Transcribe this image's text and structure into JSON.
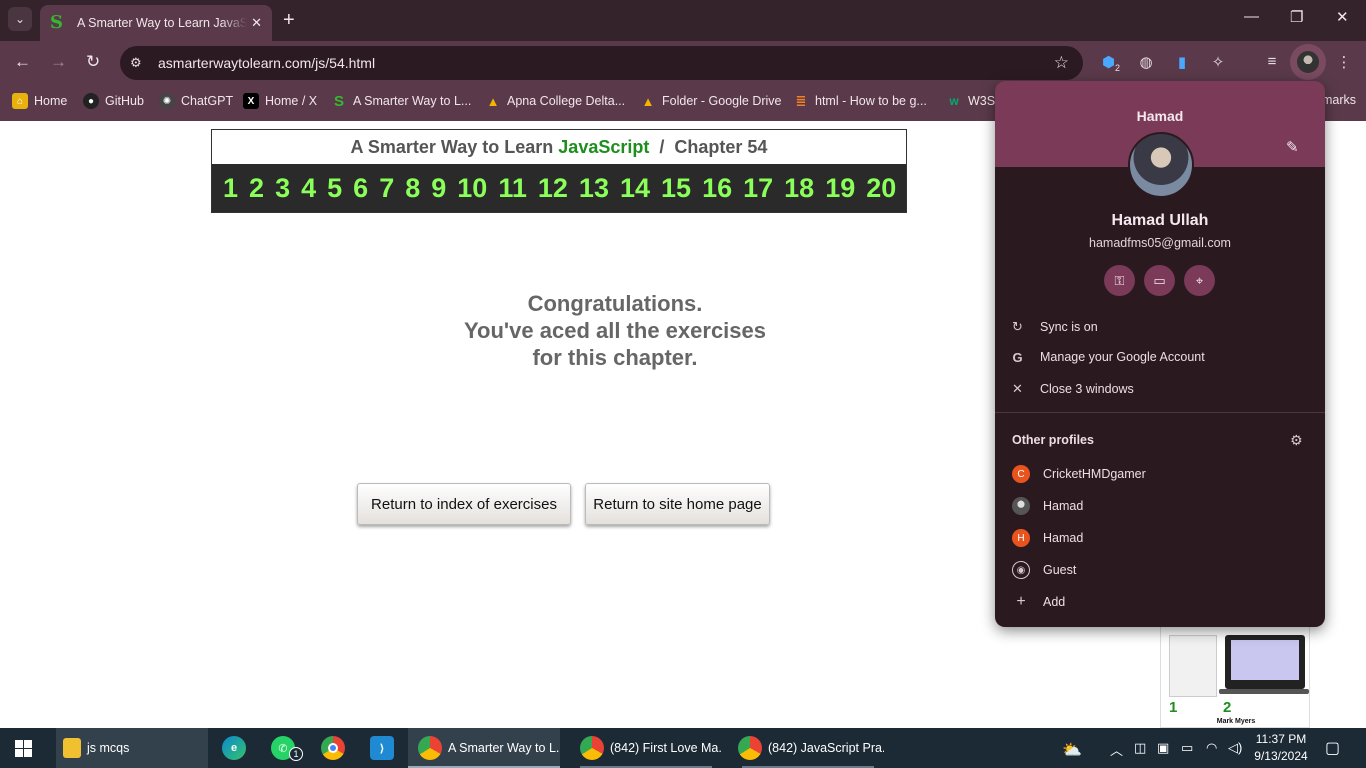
{
  "browser": {
    "tab_title": "A Smarter Way to Learn JavaScript",
    "tab_favicon": "S",
    "url": "asmarterwaytolearn.com/js/54.html"
  },
  "bookmarks": [
    {
      "label": "Home",
      "icon": "home-bookmark-icon",
      "color": "#e8b10d"
    },
    {
      "label": "GitHub",
      "icon": "github-icon",
      "color": "#222222"
    },
    {
      "label": "ChatGPT",
      "icon": "chatgpt-icon",
      "color": "#444444"
    },
    {
      "label": "Home / X",
      "icon": "x-icon",
      "color": "#000000"
    },
    {
      "label": "A Smarter Way to L...",
      "icon": "smarter-way-icon",
      "color": "#35b82f"
    },
    {
      "label": "Apna College Delta...",
      "icon": "google-drive-icon",
      "color": "#1e88e5"
    },
    {
      "label": "Folder - Google Drive",
      "icon": "google-drive-icon",
      "color": "#1e88e5"
    },
    {
      "label": "html - How to be g...",
      "icon": "stackoverflow-icon",
      "color": "#f48024"
    },
    {
      "label": "W3S",
      "icon": "w3schools-icon",
      "color": "#04aa6d"
    },
    {
      "label": "marks",
      "icon": "",
      "color": ""
    }
  ],
  "page": {
    "header_prefix": "A Smarter Way to Learn",
    "header_js": "JavaScript",
    "header_sep": "/",
    "header_chapter": "Chapter 54",
    "exercise_numbers": [
      "1",
      "2",
      "3",
      "4",
      "5",
      "6",
      "7",
      "8",
      "9",
      "10",
      "11",
      "12",
      "13",
      "14",
      "15",
      "16",
      "17",
      "18",
      "19",
      "20"
    ],
    "congrats_line1": "Congratulations.",
    "congrats_line2": "You've aced all the exercises",
    "congrats_line3": "for this chapter.",
    "btn_index": "Return to index of exercises",
    "btn_home": "Return to site home page",
    "ad_author": "Mark Myers"
  },
  "profile_popup": {
    "profile_name_top": "Hamad",
    "full_name": "Hamad Ullah",
    "email": "hamadfms05@gmail.com",
    "sync_label": "Sync is on",
    "manage_label": "Manage your Google Account",
    "close_label": "Close 3 windows",
    "other_profiles_title": "Other profiles",
    "other_profiles": [
      {
        "name": "CricketHMDgamer",
        "initial": "C",
        "color": "#e9541e"
      },
      {
        "name": "Hamad",
        "initial": "",
        "color": "#777777"
      },
      {
        "name": "Hamad",
        "initial": "H",
        "color": "#e9541e"
      },
      {
        "name": "Guest",
        "initial": "",
        "color": ""
      }
    ],
    "add_label": "Add"
  },
  "toolbar": {
    "extension_badge": "2"
  },
  "taskbar": {
    "items": [
      {
        "label": "js mcqs",
        "icon": "folder-icon"
      },
      {
        "label": "A Smarter Way to L...",
        "icon": "chrome-icon"
      },
      {
        "label": "(842) First Love Ma...",
        "icon": "chrome-icon"
      },
      {
        "label": "(842) JavaScript Pra...",
        "icon": "chrome-icon"
      }
    ],
    "whatsapp_badge": "1",
    "time": "11:37 PM",
    "date": "9/13/2024"
  }
}
